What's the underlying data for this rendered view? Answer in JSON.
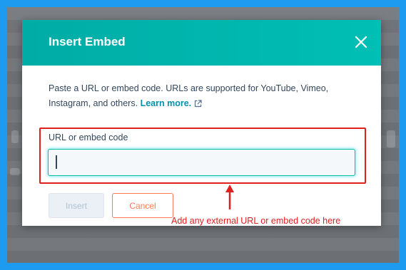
{
  "dialog": {
    "title": "Insert Embed",
    "close_icon": "close-icon",
    "description": "Paste a URL or embed code. URLs are supported for YouTube, Vimeo, Instagram, and others.",
    "learn_more": "Learn more.",
    "external_link_icon": "external-link-icon",
    "field_label": "URL or embed code",
    "field_value": "",
    "field_placeholder": "",
    "insert_label": "Insert",
    "cancel_label": "Cancel"
  },
  "annotation": {
    "text": "Add any external URL or embed code here",
    "color": "#e01f1f"
  },
  "colors": {
    "header": "#00bda5",
    "link": "#0091ae",
    "cancel": "#ff7a59",
    "page_border": "#1d9bf0"
  }
}
